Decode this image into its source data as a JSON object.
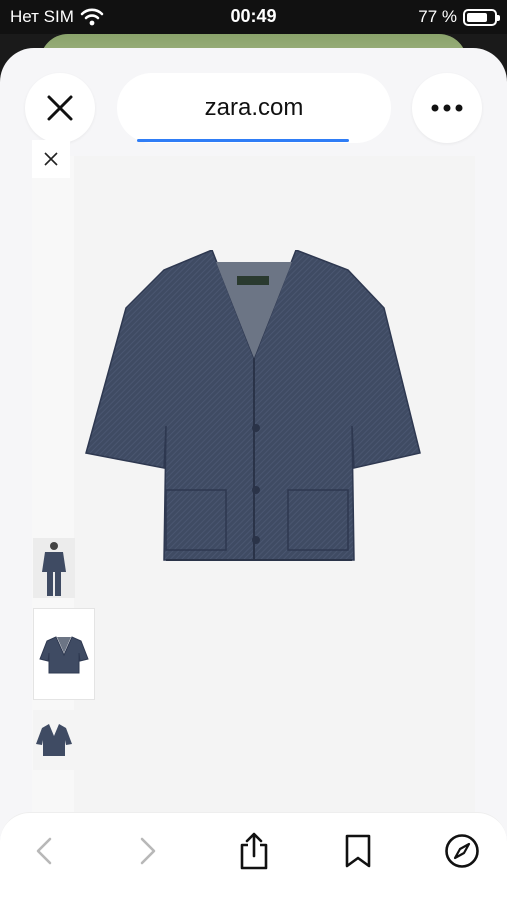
{
  "status_bar": {
    "carrier": "Нет SIM",
    "time": "00:49",
    "battery_percent_label": "77 %",
    "battery_level": 0.77,
    "icons": [
      "wifi-icon",
      "battery-icon"
    ]
  },
  "browser": {
    "url": "zara.com",
    "close_icon": "close-icon",
    "more_icon": "more-icon",
    "load_progress": 0.85,
    "accent_color": "#2f7df6"
  },
  "gallery": {
    "close_icon": "close-icon",
    "thumbnails": [
      "model-full-look",
      "front-view",
      "flat-view"
    ]
  },
  "toolbar": {
    "icons": [
      "back-icon",
      "forward-icon",
      "share-icon",
      "bookmark-icon",
      "safari-compass-icon"
    ]
  },
  "colors": {
    "denim": "#3f4b63",
    "denim_dark": "#2e3850",
    "sheet_bg": "#f6f6f8"
  }
}
